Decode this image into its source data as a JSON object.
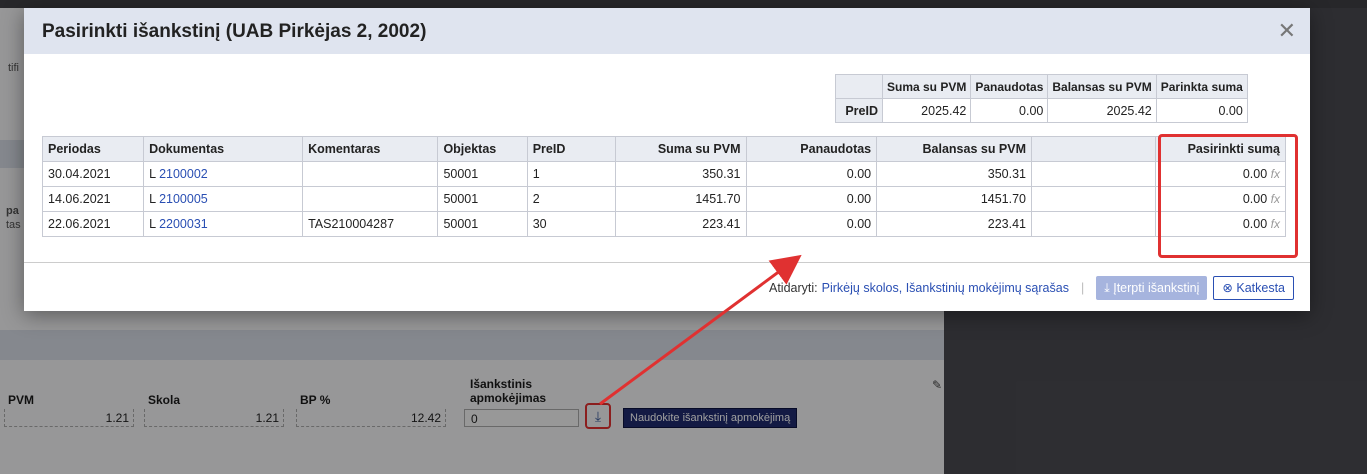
{
  "background": {
    "frag_top": "tifi",
    "frag_mid1": "pa",
    "frag_mid2": "tas",
    "form": {
      "labels": {
        "pvm": "PVM",
        "skola": "Skola",
        "bp": "BP %",
        "isankstinis": "Išankstinis apmokėjimas"
      },
      "values": {
        "pvm": "1.21",
        "skola": "1.21",
        "bp": "12.42",
        "isankstinis": "0"
      },
      "use_button": "Naudokite išankstinį apmokėjimą",
      "download_icon": "download-icon"
    }
  },
  "modal": {
    "title": "Pasirinkti išankstinį (UAB Pirkėjas 2, 2002)",
    "close_icon": "close-icon",
    "summary": {
      "headers": [
        "Suma su PVM",
        "Panaudotas",
        "Balansas su PVM",
        "Parinkta suma"
      ],
      "row_label": "PreID",
      "values": [
        "2025.42",
        "0.00",
        "2025.42",
        "0.00"
      ]
    },
    "table": {
      "headers": [
        "Periodas",
        "Dokumentas",
        "Komentaras",
        "Objektas",
        "PreID",
        "Suma su PVM",
        "Panaudotas",
        "Balansas su PVM",
        "",
        "Pasirinkti sumą"
      ],
      "rows": [
        {
          "periodas": "30.04.2021",
          "doc_prefix": "L",
          "doc_num": "2100002",
          "komentaras": "",
          "objektas": "50001",
          "preid": "1",
          "suma": "350.31",
          "panaudotas": "0.00",
          "balansas": "350.31",
          "pasirinkti": "0.00",
          "fx": "fx"
        },
        {
          "periodas": "14.06.2021",
          "doc_prefix": "L",
          "doc_num": "2100005",
          "komentaras": "",
          "objektas": "50001",
          "preid": "2",
          "suma": "1451.70",
          "panaudotas": "0.00",
          "balansas": "1451.70",
          "pasirinkti": "0.00",
          "fx": "fx"
        },
        {
          "periodas": "22.06.2021",
          "doc_prefix": "L",
          "doc_num": "2200031",
          "komentaras": "TAS210004287",
          "objektas": "50001",
          "preid": "30",
          "suma": "223.41",
          "panaudotas": "0.00",
          "balansas": "223.41",
          "pasirinkti": "0.00",
          "fx": "fx"
        }
      ]
    },
    "footer": {
      "open_label": "Atidaryti:",
      "link": "Pirkėjų skolos, Išankstinių mokėjimų sąrašas",
      "separator": "|",
      "insert_button": "Įterpti išankstinį",
      "cancel_button": "Katkesta"
    }
  },
  "colors": {
    "highlight": "#e03131",
    "link": "#2a4fb3",
    "header_bg": "#dfe4ef",
    "dark_button": "#1f2b6e"
  }
}
